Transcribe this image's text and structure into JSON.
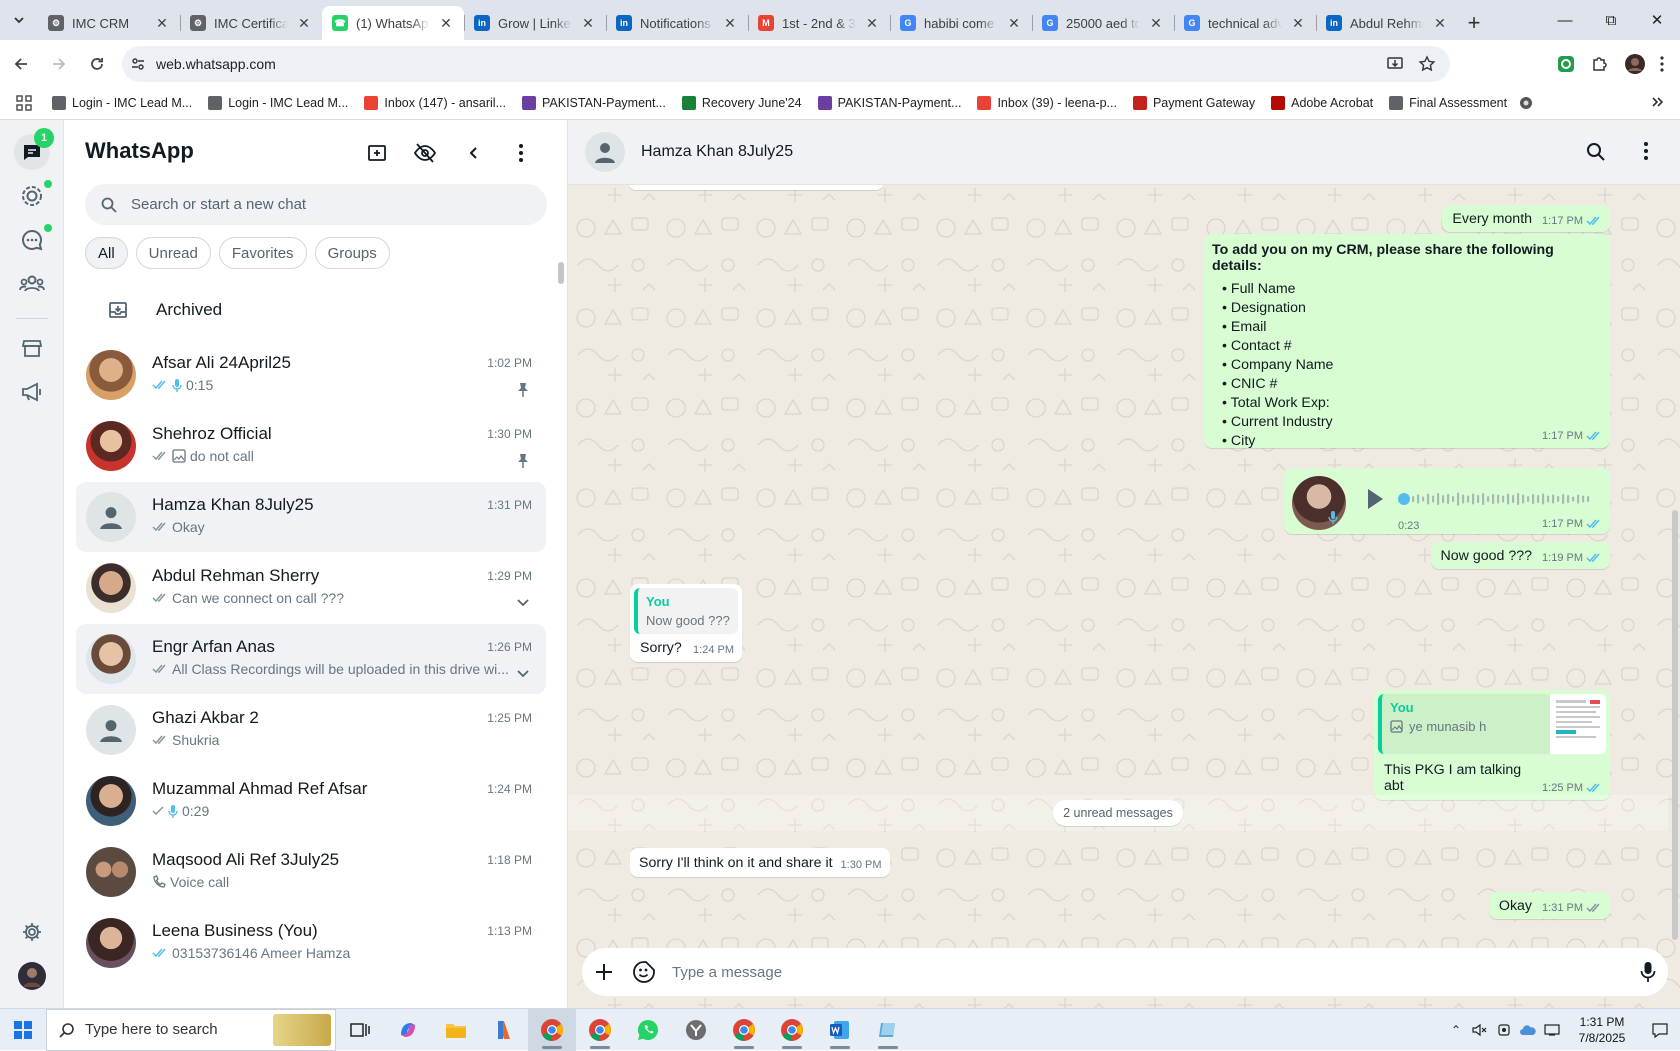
{
  "browser": {
    "tabs": [
      {
        "label": "IMC CRM",
        "fav": "imc",
        "active": false
      },
      {
        "label": "IMC Certifica",
        "fav": "imc",
        "active": false
      },
      {
        "label": "(1) WhatsApp",
        "fav": "whatsapp",
        "active": true
      },
      {
        "label": "Grow | Linked",
        "fav": "linkedin",
        "active": false
      },
      {
        "label": "Notifications",
        "fav": "linkedin",
        "active": false
      },
      {
        "label": "1st - 2nd & 3",
        "fav": "gmail",
        "active": false
      },
      {
        "label": "habibi come t",
        "fav": "google",
        "active": false
      },
      {
        "label": "25000 aed to",
        "fav": "google",
        "active": false
      },
      {
        "label": "technical adv",
        "fav": "google",
        "active": false
      },
      {
        "label": "Abdul Rehma",
        "fav": "linkedin",
        "active": false
      }
    ],
    "url": "web.whatsapp.com",
    "bookmarks": [
      {
        "label": "Login - IMC Lead M...",
        "fav": "imc"
      },
      {
        "label": "Login - IMC Lead M...",
        "fav": "imc"
      },
      {
        "label": "Inbox (147) - ansaril...",
        "fav": "gmail"
      },
      {
        "label": "PAKISTAN-Payment...",
        "fav": "purple"
      },
      {
        "label": "Recovery June'24",
        "fav": "green"
      },
      {
        "label": "PAKISTAN-Payment...",
        "fav": "purple"
      },
      {
        "label": "Inbox (39) - leena-p...",
        "fav": "gmail"
      },
      {
        "label": "Payment Gateway",
        "fav": "red"
      },
      {
        "label": "Adobe Acrobat",
        "fav": "adobe"
      },
      {
        "label": "Final Assessment",
        "fav": "imc"
      }
    ]
  },
  "whatsapp": {
    "app_title": "WhatsApp",
    "rail_badge": "1",
    "search_placeholder": "Search or start a new chat",
    "filters": [
      "All",
      "Unread",
      "Favorites",
      "Groups"
    ],
    "archived_label": "Archived",
    "chats": [
      {
        "name": "Afsar Ali 24April25",
        "time": "1:02 PM",
        "preview": "0:15",
        "prev_icon": "mic",
        "ticks": "read",
        "extra": "pin",
        "avatar": "photo-warm",
        "selected": false
      },
      {
        "name": "Shehroz Official",
        "time": "1:30 PM",
        "preview": "do not call",
        "prev_icon": "image",
        "ticks": "delivered",
        "extra": "pin",
        "avatar": "photo-red",
        "selected": false
      },
      {
        "name": "Hamza Khan 8July25",
        "time": "1:31 PM",
        "preview": "Okay",
        "prev_icon": "",
        "ticks": "delivered",
        "extra": "",
        "avatar": "default",
        "selected": true
      },
      {
        "name": "Abdul Rehman Sherry",
        "time": "1:29 PM",
        "preview": "Can we connect on call ???",
        "prev_icon": "",
        "ticks": "delivered",
        "extra": "chevron",
        "avatar": "photo-beige",
        "selected": false
      },
      {
        "name": "Engr Arfan Anas",
        "time": "1:26 PM",
        "preview": "All Class Recordings will be uploaded in this drive wi...",
        "prev_icon": "",
        "ticks": "delivered",
        "extra": "chevron",
        "avatar": "photo-light",
        "selected": true
      },
      {
        "name": "Ghazi Akbar 2",
        "time": "1:25 PM",
        "preview": "Shukria",
        "prev_icon": "",
        "ticks": "delivered",
        "extra": "",
        "avatar": "default",
        "selected": false
      },
      {
        "name": "Muzammal Ahmad Ref Afsar",
        "time": "1:24 PM",
        "preview": "0:29",
        "prev_icon": "mic",
        "ticks": "sent",
        "extra": "",
        "avatar": "photo-blue",
        "selected": false
      },
      {
        "name": "Maqsood Ali Ref 3July25",
        "time": "1:18 PM",
        "preview": "Voice call",
        "prev_icon": "call",
        "ticks": "",
        "extra": "",
        "avatar": "photo-group",
        "selected": false
      },
      {
        "name": "Leena Business (You)",
        "time": "1:13 PM",
        "preview": "03153736146 Ameer Hamza",
        "prev_icon": "",
        "ticks": "read",
        "extra": "",
        "avatar": "photo-woman",
        "selected": false
      }
    ],
    "conversation": {
      "contact": "Hamza Khan 8July25",
      "msg_every_month": {
        "text": "Every month",
        "time": "1:17 PM"
      },
      "crm_message": {
        "heading": "To add you on my CRM, please share the following details:",
        "items": [
          "Full Name",
          "Designation",
          "Email",
          "Contact #",
          "Company Name",
          "CNIC #",
          "Total Work Exp:",
          "Current Industry",
          "City"
        ],
        "time": "1:17 PM"
      },
      "voice_note": {
        "duration": "0:23",
        "time": "1:17 PM",
        "progress": 0
      },
      "msg_now_good": {
        "text": "Now good ???",
        "time": "1:19 PM"
      },
      "reply_sorry": {
        "quote_author": "You",
        "quote_text": "Now good ???",
        "text": "Sorry?",
        "time": "1:24 PM"
      },
      "reply_pkg": {
        "quote_author": "You",
        "quote_text": "ye munasib h",
        "text": "This PKG I am talking abt",
        "time": "1:25 PM"
      },
      "unread_divider": "2 unread messages",
      "msg_think": {
        "text": "Sorry I'll think on it and share it",
        "time": "1:30 PM"
      },
      "msg_okay": {
        "text": "Okay",
        "time": "1:31 PM"
      },
      "composer_placeholder": "Type a message"
    }
  },
  "taskbar": {
    "search_placeholder": "Type here to search",
    "time": "1:31 PM",
    "date": "7/8/2025"
  },
  "colors": {
    "outgoing_bubble": "#d9fdd3",
    "incoming_bubble": "#ffffff",
    "wa_green": "#25d366",
    "read_tick": "#53bdeb",
    "quote_accent": "#06cf9c"
  }
}
